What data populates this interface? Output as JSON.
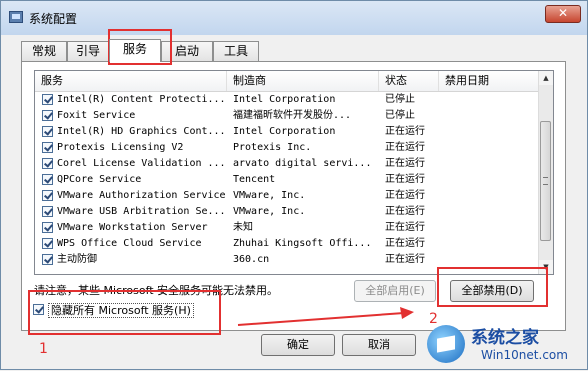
{
  "window": {
    "title": "系统配置",
    "close_label": "✕"
  },
  "tabs": [
    "常规",
    "引导",
    "服务",
    "启动",
    "工具"
  ],
  "active_tab": "服务",
  "columns": [
    "服务",
    "制造商",
    "状态",
    "禁用日期"
  ],
  "services": [
    {
      "name": "Intel(R) Content Protecti...",
      "manufacturer": "Intel Corporation",
      "status": "已停止",
      "checked": true
    },
    {
      "name": "Foxit Service",
      "manufacturer": "福建福昕软件开发股份...",
      "status": "已停止",
      "checked": true
    },
    {
      "name": "Intel(R) HD Graphics Cont...",
      "manufacturer": "Intel Corporation",
      "status": "正在运行",
      "checked": true
    },
    {
      "name": "Protexis Licensing V2",
      "manufacturer": "Protexis Inc.",
      "status": "正在运行",
      "checked": true
    },
    {
      "name": "Corel License Validation ...",
      "manufacturer": "arvato digital servi...",
      "status": "正在运行",
      "checked": true
    },
    {
      "name": "QPCore Service",
      "manufacturer": "Tencent",
      "status": "正在运行",
      "checked": true
    },
    {
      "name": "VMware Authorization Service",
      "manufacturer": "VMware, Inc.",
      "status": "正在运行",
      "checked": true
    },
    {
      "name": "VMware USB Arbitration Se...",
      "manufacturer": "VMware, Inc.",
      "status": "正在运行",
      "checked": true
    },
    {
      "name": "VMware Workstation Server",
      "manufacturer": "未知",
      "status": "正在运行",
      "checked": true
    },
    {
      "name": "WPS Office Cloud Service",
      "manufacturer": "Zhuhai Kingsoft Offi...",
      "status": "正在运行",
      "checked": true
    },
    {
      "name": "主动防御",
      "manufacturer": "360.cn",
      "status": "正在运行",
      "checked": true
    }
  ],
  "note": "请注意，某些 Microsoft 安全服务可能无法禁用。",
  "buttons": {
    "enable_all": "全部启用(E)",
    "disable_all": "全部禁用(D)",
    "ok": "确定",
    "cancel": "取消"
  },
  "hide_ms": {
    "label": "隐藏所有 Microsoft 服务(H)",
    "checked": true
  },
  "annotations": {
    "step1": "1",
    "step2": "2"
  },
  "watermark": {
    "title": "系统之家",
    "url": "Win10net.com"
  },
  "colors": {
    "annotation_red": "#e23030",
    "watermark_blue": "#1c4ea3"
  }
}
